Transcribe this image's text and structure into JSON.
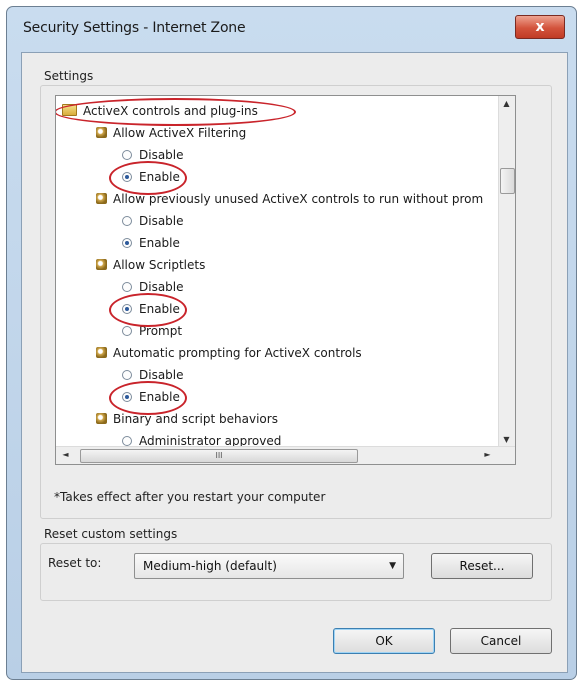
{
  "window": {
    "title": "Security Settings - Internet Zone",
    "close_glyph": "x"
  },
  "settings": {
    "group_label": "Settings",
    "items": [
      {
        "kind": "category",
        "label": "ActiveX controls and plug-ins",
        "icon": "folder-icon"
      },
      {
        "kind": "setting",
        "label": "Allow ActiveX Filtering",
        "icon": "settings-icon"
      },
      {
        "kind": "option",
        "label": "Disable",
        "checked": false
      },
      {
        "kind": "option",
        "label": "Enable",
        "checked": true
      },
      {
        "kind": "setting",
        "label": "Allow previously unused ActiveX controls to run without prom",
        "icon": "settings-icon"
      },
      {
        "kind": "option",
        "label": "Disable",
        "checked": false
      },
      {
        "kind": "option",
        "label": "Enable",
        "checked": true
      },
      {
        "kind": "setting",
        "label": "Allow Scriptlets",
        "icon": "settings-icon"
      },
      {
        "kind": "option",
        "label": "Disable",
        "checked": false
      },
      {
        "kind": "option",
        "label": "Enable",
        "checked": true
      },
      {
        "kind": "option",
        "label": "Prompt",
        "checked": false
      },
      {
        "kind": "setting",
        "label": "Automatic prompting for ActiveX controls",
        "icon": "settings-icon"
      },
      {
        "kind": "option",
        "label": "Disable",
        "checked": false
      },
      {
        "kind": "option",
        "label": "Enable",
        "checked": true
      },
      {
        "kind": "setting",
        "label": "Binary and script behaviors",
        "icon": "settings-icon"
      },
      {
        "kind": "option",
        "label": "Administrator approved",
        "checked": false
      }
    ],
    "hscroll_grip": "III",
    "scroll_up": "▲",
    "scroll_down": "▼",
    "scroll_left": "◄",
    "scroll_right": "►",
    "highlight_color": "#c9242b",
    "footnote": "*Takes effect after you restart your computer"
  },
  "reset": {
    "group_label": "Reset custom settings",
    "field_label": "Reset to:",
    "selected": "Medium-high (default)",
    "dropdown_icon": "▼",
    "reset_button": "Reset..."
  },
  "footer": {
    "ok": "OK",
    "cancel": "Cancel"
  }
}
